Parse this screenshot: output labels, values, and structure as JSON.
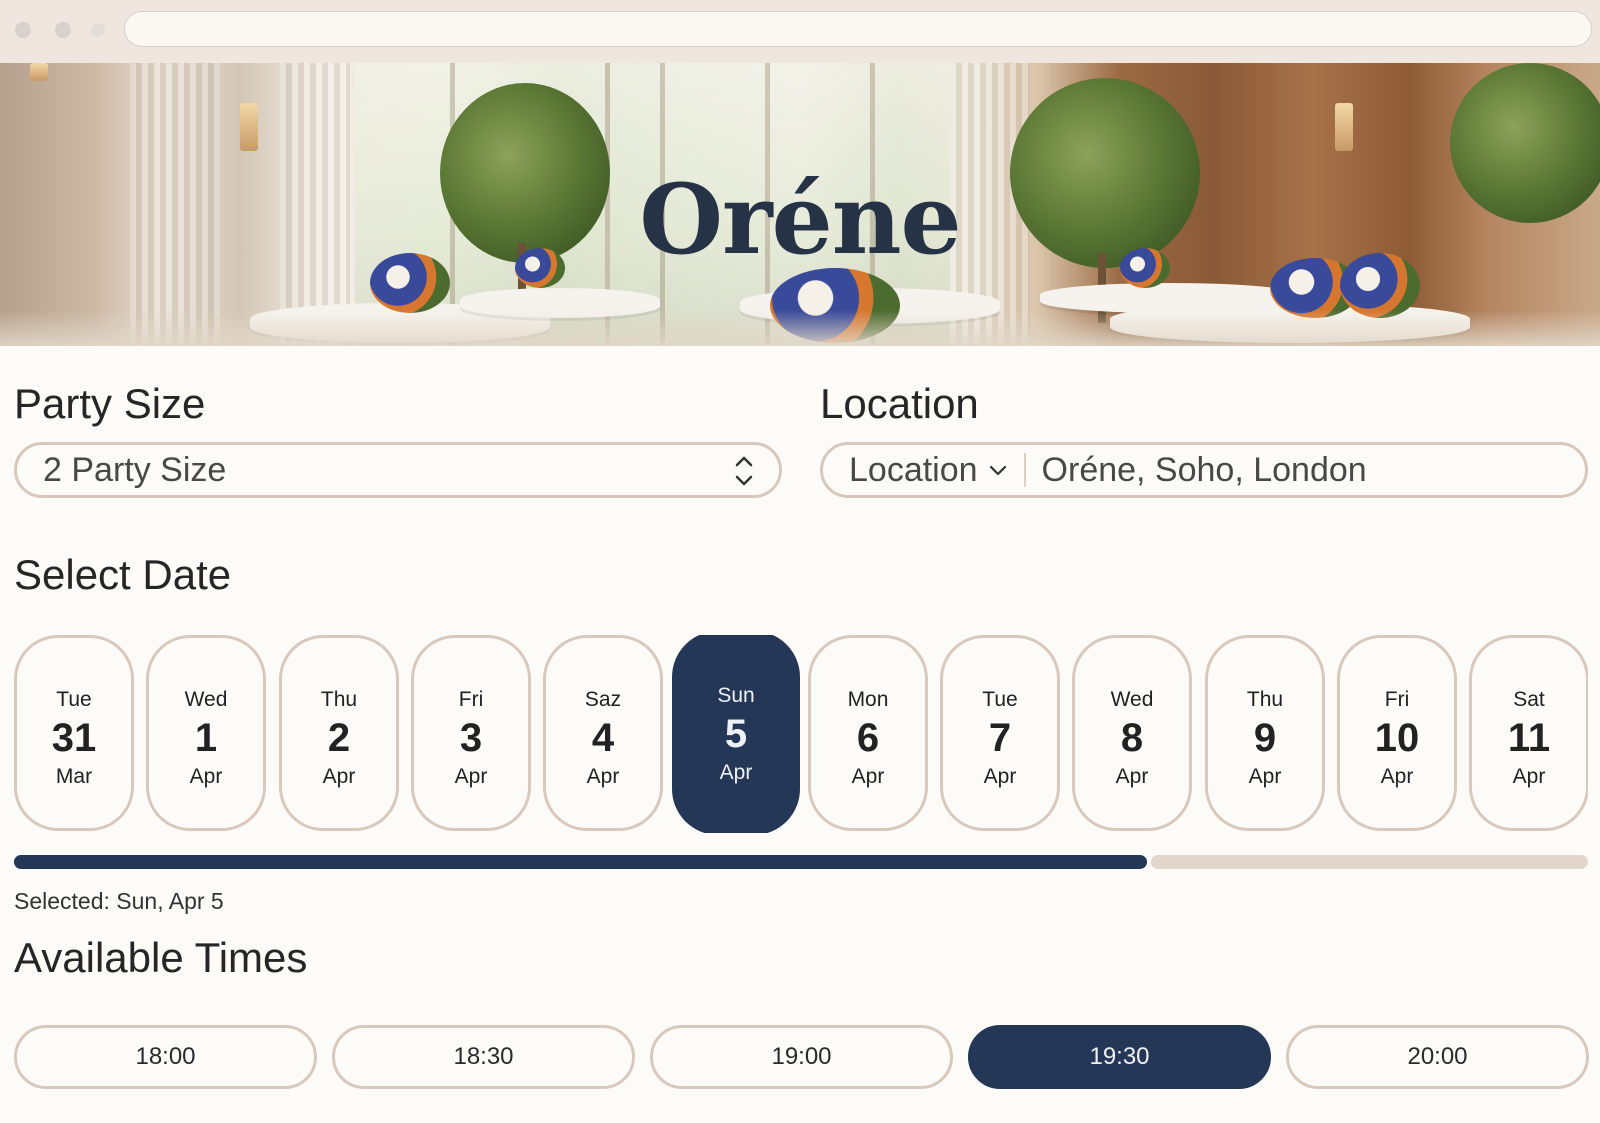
{
  "hero": {
    "title": "Oréne"
  },
  "party": {
    "label": "Party Size",
    "value": "2 Party Size"
  },
  "location": {
    "label": "Location",
    "prefix": "Location",
    "value": "Oréne, Soho, London"
  },
  "dates": {
    "label": "Select Date",
    "items": [
      {
        "dow": "Tue",
        "day": "31",
        "mon": "Mar",
        "selected": false
      },
      {
        "dow": "Wed",
        "day": "1",
        "mon": "Apr",
        "selected": false
      },
      {
        "dow": "Thu",
        "day": "2",
        "mon": "Apr",
        "selected": false
      },
      {
        "dow": "Fri",
        "day": "3",
        "mon": "Apr",
        "selected": false
      },
      {
        "dow": "Saz",
        "day": "4",
        "mon": "Apr",
        "selected": false
      },
      {
        "dow": "Sun",
        "day": "5",
        "mon": "Apr",
        "selected": true
      },
      {
        "dow": "Mon",
        "day": "6",
        "mon": "Apr",
        "selected": false
      },
      {
        "dow": "Tue",
        "day": "7",
        "mon": "Apr",
        "selected": false
      },
      {
        "dow": "Wed",
        "day": "8",
        "mon": "Apr",
        "selected": false
      },
      {
        "dow": "Thu",
        "day": "9",
        "mon": "Apr",
        "selected": false
      },
      {
        "dow": "Fri",
        "day": "10",
        "mon": "Apr",
        "selected": false
      },
      {
        "dow": "Sat",
        "day": "11",
        "mon": "Apr",
        "selected": false
      }
    ],
    "scroll_progress": 0.72,
    "selected_text": "Selected: Sun, Apr 5"
  },
  "times": {
    "label": "Available Times",
    "items": [
      {
        "label": "18:00",
        "selected": false
      },
      {
        "label": "18:30",
        "selected": false
      },
      {
        "label": "19:00",
        "selected": false
      },
      {
        "label": "19:30",
        "selected": true
      },
      {
        "label": "20:00",
        "selected": false
      }
    ]
  },
  "colors": {
    "accent": "#253756",
    "border": "#d9c9bc",
    "background": "#fdfbf8"
  }
}
